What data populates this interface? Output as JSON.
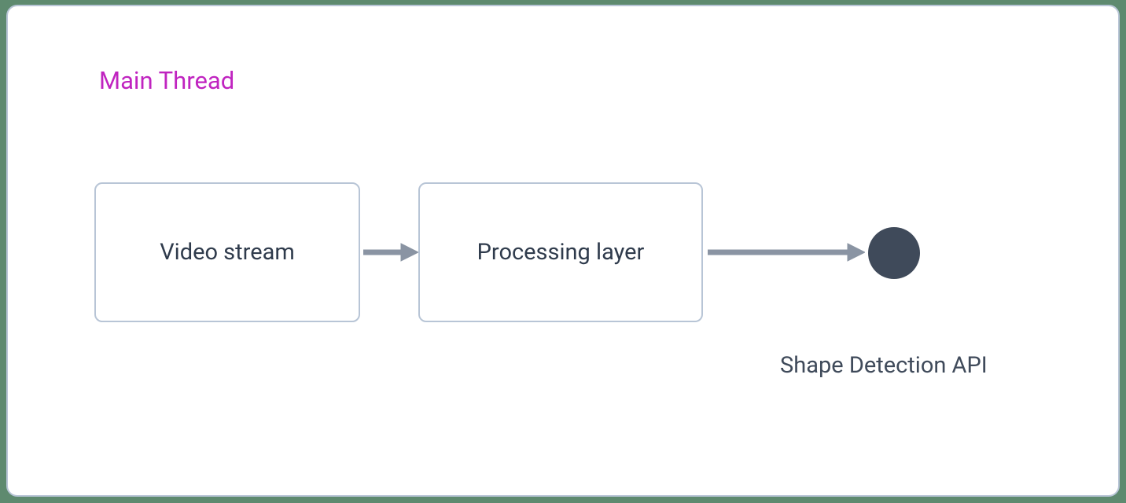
{
  "section_title": "Main Thread",
  "nodes": {
    "video_stream": "Video stream",
    "processing_layer": "Processing layer",
    "shape_detection_api": "Shape Detection API"
  },
  "colors": {
    "accent_title": "#c024c0",
    "box_border": "#b8c5d6",
    "text": "#2f3b4c",
    "arrow": "#8a94a3",
    "dot": "#3f4a5a"
  }
}
